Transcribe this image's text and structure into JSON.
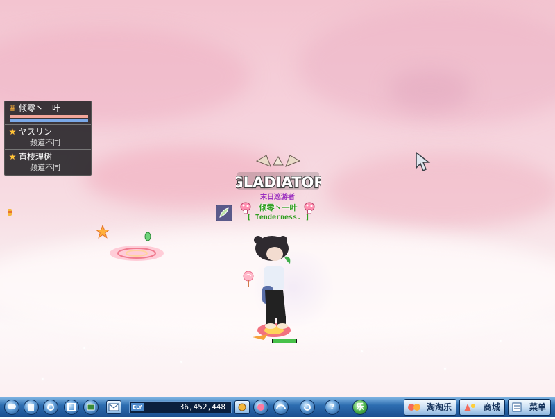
{
  "party": {
    "members": [
      {
        "name": "倾零丶一叶",
        "icon": "crown-icon",
        "hp_fraction": 1.0,
        "mp_fraction": 1.0
      },
      {
        "name": "ヤスリン",
        "status": "频道不同",
        "icon": "star-icon"
      },
      {
        "name": "直枝理树",
        "status": "频道不同",
        "icon": "star-icon"
      }
    ]
  },
  "character": {
    "medal": "GLADIATOR",
    "guild_rank": "末日巡游者",
    "name": "倾零丶一叶",
    "guild": "[ Tenderness. ]",
    "hp_fraction": 1.0
  },
  "bottom_bar": {
    "meso_tag": "ELY",
    "meso": "36,452,448",
    "buttons": {
      "happy": "乐",
      "taotaole": "淘淘乐",
      "shop": "商城",
      "menu": "菜单",
      "help": "?"
    }
  },
  "colors": {
    "sky_top": "#f3c4d0",
    "sky_bottom": "#fdf8f9",
    "name_green": "#2f9e1f",
    "rank_purple": "#9b2fbf",
    "bar_blue": "#2d6db0"
  }
}
